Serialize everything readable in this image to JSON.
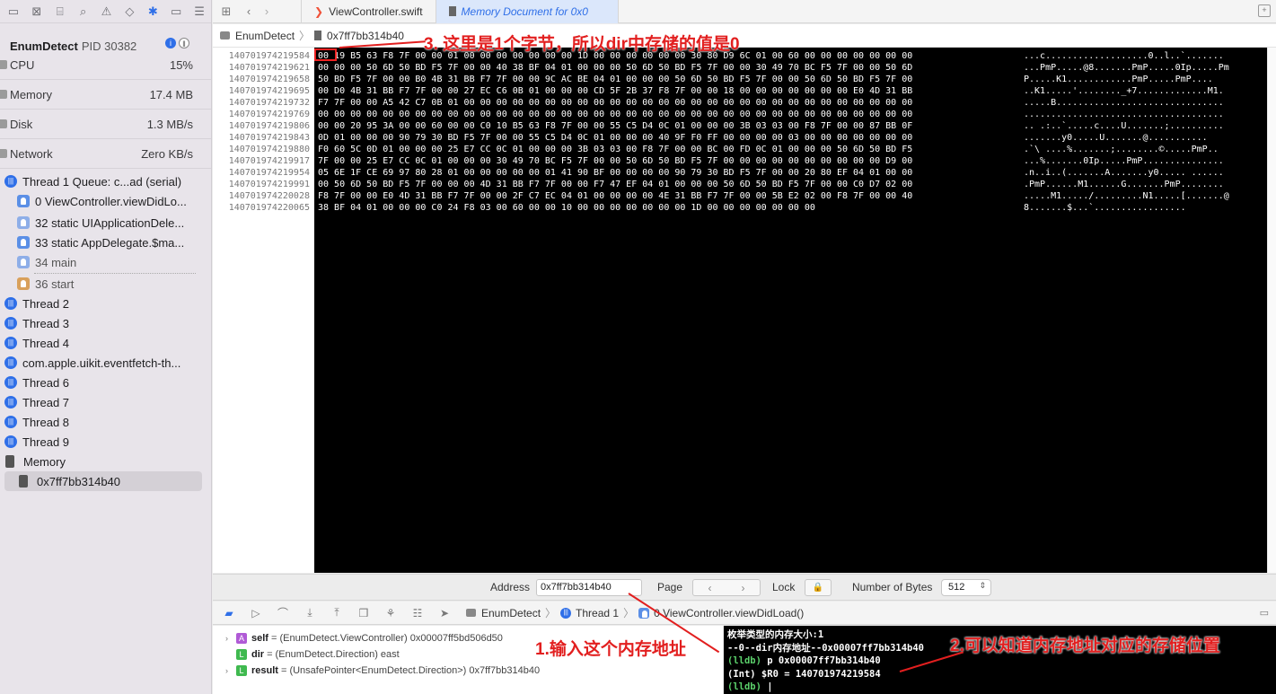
{
  "sidebar": {
    "process_name": "EnumDetect",
    "process_pid": "PID 30382",
    "gauges": [
      {
        "label": "CPU",
        "value": "15%"
      },
      {
        "label": "Memory",
        "value": "17.4 MB"
      },
      {
        "label": "Disk",
        "value": "1.3 MB/s"
      },
      {
        "label": "Network",
        "value": "Zero KB/s"
      }
    ],
    "thread1": "Thread 1 Queue: c...ad (serial)",
    "frames": [
      "0 ViewController.viewDidLo...",
      "32 static UIApplicationDele...",
      "33 static AppDelegate.$ma...",
      "34 main",
      "36 start"
    ],
    "threads": [
      "Thread 2",
      "Thread 3",
      "Thread 4",
      "com.apple.uikit.eventfetch-th...",
      "Thread 6",
      "Thread 7",
      "Thread 8",
      "Thread 9"
    ],
    "memory_group": "Memory",
    "memory_item": "0x7ff7bb314b40"
  },
  "tabs": {
    "tab1": "ViewController.swift",
    "tab2": "Memory Document for 0x0"
  },
  "breadcrumb": {
    "project": "EnumDetect",
    "item": "0x7ff7bb314b40"
  },
  "memory": {
    "addresses": [
      "140701974219584",
      "140701974219621",
      "140701974219658",
      "140701974219695",
      "140701974219732",
      "140701974219769",
      "140701974219806",
      "140701974219843",
      "140701974219880",
      "140701974219917",
      "140701974219954",
      "140701974219991",
      "140701974220028",
      "140701974220065"
    ],
    "hex": [
      "00 19 B5 63 F8 7F 00 00 01 00 00 00 00 00 00 00 1D 00 00 00 00 00 00 30 80 D9 6C 01 00 60 00 00 00 00 00 00 00",
      "00 00 00 50 6D 50 BD F5 7F 00 00 40 38 BF 04 01 00 00 00 50 6D 50 BD F5 7F 00 00 30 49 70 BC F5 7F 00 00 50 6D",
      "50 BD F5 7F 00 00 B0 4B 31 BB F7 7F 00 00 9C AC BE 04 01 00 00 00 50 6D 50 BD F5 7F 00 00 50 6D 50 BD F5 7F 00",
      "00 D0 4B 31 BB F7 7F 00 00 27 EC C6 0B 01 00 00 00 CD 5F 2B 37 F8 7F 00 00 18 00 00 00 00 00 00 00 E0 4D 31 BB",
      "F7 7F 00 00 A5 42 C7 0B 01 00 00 00 00 00 00 00 00 00 00 00 00 00 00 00 00 00 00 00 00 00 00 00 00 00 00 00 00",
      "00 00 00 00 00 00 00 00 00 00 00 00 00 00 00 00 00 00 00 00 00 00 00 00 00 00 00 00 00 00 00 00 00 00 00 00 00",
      "00 00 20 95 3A 00 00 60 00 00 C0 10 B5 63 F8 7F 00 00 55 C5 D4 0C 01 00 00 00 3B 03 03 00 F8 7F 00 00 87 BB 0F",
      "0D 01 00 00 00 90 79 30 BD F5 7F 00 00 55 C5 D4 0C 01 00 00 00 40 9F F0 FF 00 00 00 00 03 00 00 00 00 00 00 00",
      "F0 60 5C 0D 01 00 00 00 25 E7 CC 0C 01 00 00 00 3B 03 03 00 F8 7F 00 00 BC 00 FD 0C 01 00 00 00 50 6D 50 BD F5",
      "7F 00 00 25 E7 CC 0C 01 00 00 00 30 49 70 BC F5 7F 00 00 50 6D 50 BD F5 7F 00 00 00 00 00 00 00 00 00 00 D9 00",
      "05 6E 1F CE 69 97 80 28 01 00 00 00 00 00 01 41 90 BF 00 00 00 00 90 79 30 BD F5 7F 00 00 20 80 EF 04 01 00 00",
      "00 50 6D 50 BD F5 7F 00 00 00 4D 31 BB F7 7F 00 00 F7 47 EF 04 01 00 00 00 50 6D 50 BD F5 7F 00 00 C0 D7 02 00",
      "F8 7F 00 00 E0 4D 31 BB F7 7F 00 00 2F C7 EC 04 01 00 00 00 00 4E 31 BB F7 7F 00 00 5B E2 02 00 F8 7F 00 00 40",
      "38 BF 04 01 00 00 00 C0 24 F8 03 00 60 00 00 10 00 00 00 00 00 00 00 1D 00 00 00 00 00 00 00"
    ],
    "ascii": [
      "...c...................0..l..`.......",
      "...PmP.....@8.......PmP.....0Ip.....Pm",
      "P.....K1............PmP.....PmP....",
      "..K1.....'........_+7.............M1.",
      ".....B...............................",
      ".....................................",
      ".. .:..`.....c....U.......;..........",
      ".......y0.....U.......@...........",
      ".`\\ ....%.......;........©.....PmP..",
      "...%.......0Ip.....PmP...............",
      ".n..i..(.......A.......y0..... ......",
      ".PmP......M1......G.......PmP........",
      ".....M1...../.........N1.....[.......@",
      "8.......$...`................."
    ]
  },
  "addressbar": {
    "address_label": "Address",
    "address_value": "0x7ff7bb314b40",
    "page_label": "Page",
    "lock_label": "Lock",
    "bytes_label": "Number of Bytes",
    "bytes_value": "512"
  },
  "debugbar": {
    "project": "EnumDetect",
    "thread": "Thread 1",
    "frame": "0 ViewController.viewDidLoad()"
  },
  "variables": [
    {
      "badge": "A",
      "name": "self",
      "value": "= (EnumDetect.ViewController) 0x00007ff5bd506d50",
      "color": "#b05ad6",
      "expand": "›"
    },
    {
      "badge": "L",
      "name": "dir",
      "value": "= (EnumDetect.Direction) east",
      "color": "#3fb94f",
      "expand": ""
    },
    {
      "badge": "L",
      "name": "result",
      "value": "= (UnsafePointer<EnumDetect.Direction>) 0x7ff7bb314b40",
      "color": "#3fb94f",
      "expand": "›"
    }
  ],
  "console": {
    "line1": "枚举类型的内存大小:1",
    "line2": "--0--dir内存地址--0x00007ff7bb314b40",
    "line3_prompt": "(lldb)",
    "line3_cmd": " p 0x00007ff7bb314b40",
    "line4": "(Int) $R0 = 140701974219584",
    "line5_prompt": "(lldb)"
  },
  "annotations": {
    "a1": "1.输入这个内存地址",
    "a2": "2.可以知道内存地址对应的存储位置",
    "a3": "3. 这里是1个字节，所以dir中存储的值是0"
  },
  "colors": {
    "accent": "#2f6fe8",
    "annotation": "#e21f1f"
  }
}
